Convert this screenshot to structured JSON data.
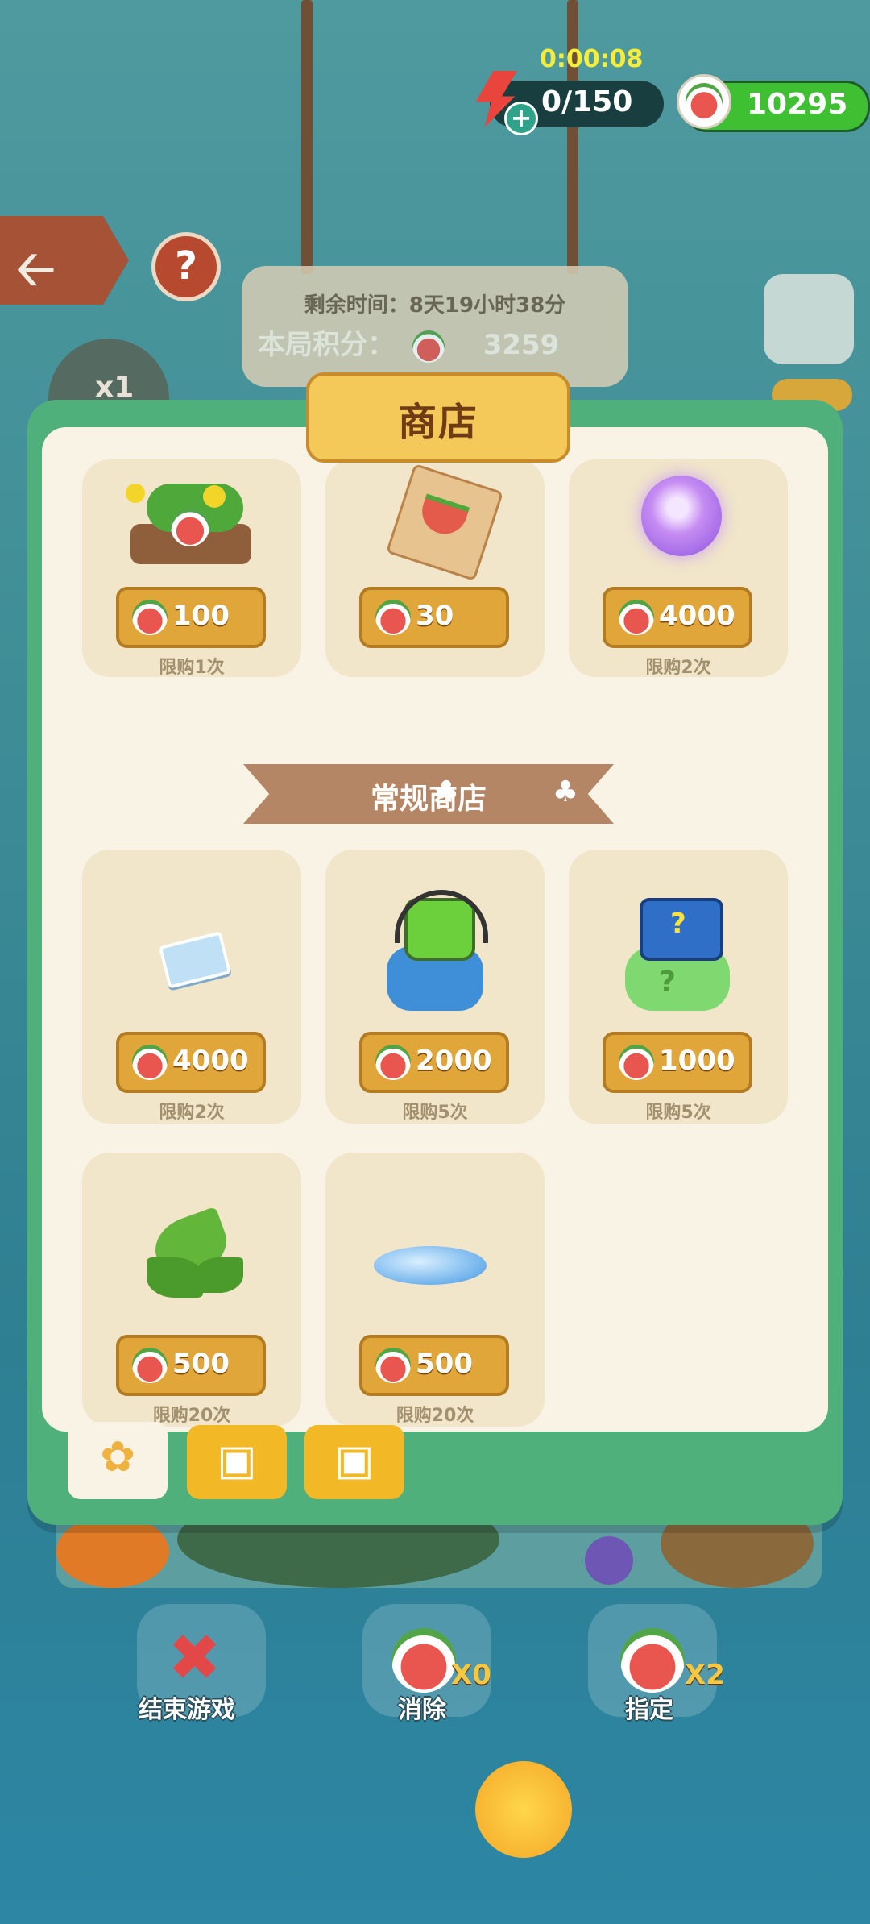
{
  "hud": {
    "timer": "0:00:08",
    "energy": "0/150",
    "coins": "10295"
  },
  "board": {
    "time_remaining": "剩余时间：8天19小时38分",
    "round_score_label": "本局积分：",
    "round_score": "3259"
  },
  "background": {
    "multiplier": "x1"
  },
  "shop": {
    "title": "商店",
    "section_regular": "常规商店",
    "top_items": [
      {
        "icon": "watermelon-patch-icon",
        "price": "100",
        "limit": "限购1次"
      },
      {
        "icon": "seed-packet-icon",
        "price": "30",
        "limit": ""
      },
      {
        "icon": "magic-orb-icon",
        "price": "4000",
        "limit": "限购2次"
      }
    ],
    "regular_items": [
      {
        "icon": "ticket-icon",
        "price": "4000",
        "limit": "限购2次"
      },
      {
        "icon": "cat-headphone-bag-icon",
        "price": "2000",
        "limit": "限购5次"
      },
      {
        "icon": "mystery-bag-icon",
        "price": "1000",
        "limit": "限购5次"
      },
      {
        "icon": "leaf-branch-icon",
        "price": "500",
        "limit": "限购20次"
      },
      {
        "icon": "water-puddle-icon",
        "price": "500",
        "limit": "限购20次"
      }
    ],
    "tabs": [
      {
        "icon": "leaf-icon",
        "active": true
      },
      {
        "icon": "gift-box-icon",
        "active": false
      },
      {
        "icon": "gift-box-icon",
        "active": false
      }
    ]
  },
  "actions": {
    "end_game": "结束游戏",
    "eliminate": "消除",
    "eliminate_count": "X0",
    "assign": "指定",
    "assign_count": "X2"
  },
  "colors": {
    "modal_frame": "#4fb07c",
    "panel": "#f8f3e4",
    "price_button": "#e1a63a",
    "title_tab": "#f4c95a"
  }
}
